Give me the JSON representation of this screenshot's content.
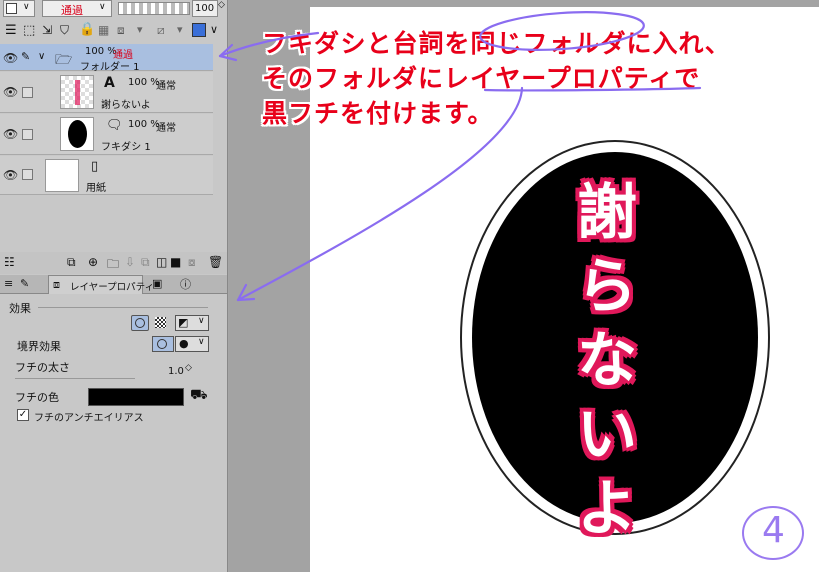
{
  "toolbar": {
    "blend_mode": "通過",
    "opacity_value": "100"
  },
  "layers": [
    {
      "opacity": "100 %",
      "mode": "通過",
      "name": "フォルダー 1"
    },
    {
      "opacity": "100 %",
      "mode": "通常",
      "name": "謝らないよ"
    },
    {
      "opacity": "100 %",
      "mode": "通常",
      "name": "フキダシ 1"
    },
    {
      "name": "用紙"
    }
  ],
  "property_panel": {
    "tab_label": "レイヤープロパティ",
    "section_effect": "効果",
    "border_effect_label": "境界効果",
    "edge_width_label": "フチの太さ",
    "edge_width_value": "1.0",
    "edge_color_label": "フチの色",
    "edge_color": "#000000",
    "antialias_label": "フチのアンチエイリアス",
    "antialias_checked": true
  },
  "annotation": {
    "line1": "フキダシと台詞を同じフォルダに入れ、",
    "line2": "そのフォルダにレイヤープロパティで",
    "line3": "黒フチを付けます。",
    "color": "#e8001a"
  },
  "canvas": {
    "speech_text": "謝らないよ",
    "chars": [
      "謝",
      "ら",
      "な",
      "い",
      "よ"
    ],
    "step_number": "4"
  },
  "colors": {
    "accent_arrow": "#8a6cf0",
    "selected_layer": "#a9bfe0",
    "text_outline": "#e0185a"
  }
}
